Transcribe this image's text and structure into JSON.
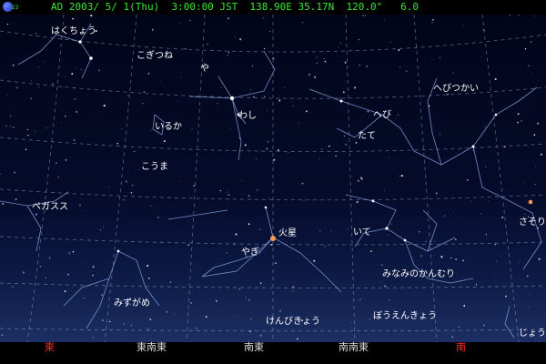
{
  "status": {
    "logo_label": "23",
    "text": "AD 2003/ 5/ 1(Thu)  3:00:00 JST  138.90E 35.17N  120.0°   6.0"
  },
  "constellations": {
    "hakuchou": "はくちょう",
    "kogitsune": "こぎつね",
    "ya": "や",
    "hebitsukai": "へびつかい",
    "iruka": "いるか",
    "washi": "わし",
    "hebi": "へび",
    "tate": "たて",
    "kouma": "こうま",
    "pegasus": "ペガスス",
    "ite": "いて",
    "sasori": "さそり",
    "yagi": "やぎ",
    "minaminokanmuri": "みなみのかんむり",
    "mizugame": "みずがめ",
    "boenkyou": "ぼうえんきょう",
    "kenbikyou": "けんびきょう",
    "jougi": "じょうぎ"
  },
  "planets": {
    "mars": "火星"
  },
  "directions": [
    {
      "label": "東",
      "color": "#ff2a2a"
    },
    {
      "label": "東南東",
      "color": "#dddddd"
    },
    {
      "label": "南東",
      "color": "#dddddd"
    },
    {
      "label": "南南東",
      "color": "#dddddd"
    },
    {
      "label": "南",
      "color": "#ff2a2a"
    }
  ],
  "colors": {
    "status_text": "#3be63b",
    "constellation_line": "#7f9bd8",
    "grid_line": "#9aa6c8",
    "mars": "#ff9a55"
  }
}
